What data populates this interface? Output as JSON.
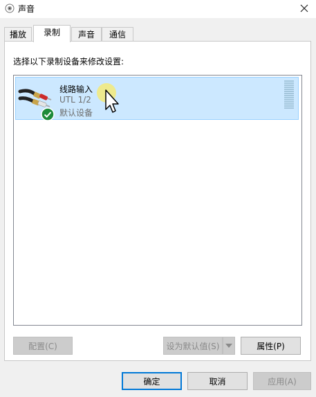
{
  "window": {
    "title": "声音"
  },
  "tabs": [
    {
      "label": "播放"
    },
    {
      "label": "录制"
    },
    {
      "label": "声音"
    },
    {
      "label": "通信"
    }
  ],
  "panel": {
    "instruction": "选择以下录制设备来修改设置:",
    "devices": [
      {
        "name": "线路输入",
        "model": "UTL 1/2",
        "status": "默认设备",
        "icon": "line-in-cable-icon",
        "status_icon": "check-icon"
      }
    ]
  },
  "panel_buttons": {
    "configure": "配置(C)",
    "set_default": "设为默认值(S)",
    "properties": "属性(P)"
  },
  "dialog_buttons": {
    "ok": "确定",
    "cancel": "取消",
    "apply": "应用(A)"
  },
  "colors": {
    "selection": "#cce8ff",
    "selection_border": "#99d1ff",
    "default_button_border": "#0078d7",
    "check_badge": "#1e8b3a"
  }
}
